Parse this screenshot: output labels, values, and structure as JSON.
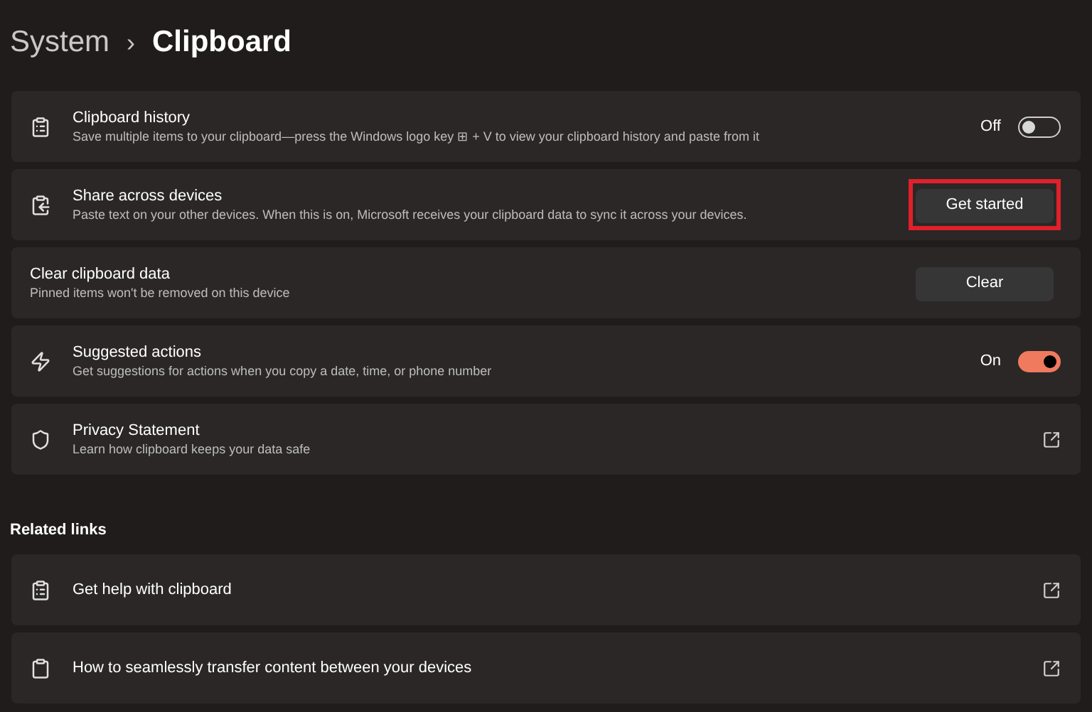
{
  "breadcrumb": {
    "parent": "System",
    "separator": "›",
    "current": "Clipboard"
  },
  "settings": [
    {
      "kind": "toggle",
      "title": "Clipboard history",
      "description": "Save multiple items to your clipboard—press the Windows logo key ⊞ + V to view your clipboard history and paste from it",
      "state_label": "Off",
      "on": false
    },
    {
      "kind": "button",
      "title": "Share across devices",
      "description": "Paste text on your other devices. When this is on, Microsoft receives your clipboard data to sync it across your devices.",
      "button": "Get started",
      "highlighted": true
    },
    {
      "kind": "button",
      "title": "Clear clipboard data",
      "description": "Pinned items won't be removed on this device",
      "button": "Clear",
      "highlighted": false
    },
    {
      "kind": "toggle",
      "title": "Suggested actions",
      "description": "Get suggestions for actions when you copy a date, time, or phone number",
      "state_label": "On",
      "on": true
    },
    {
      "kind": "link",
      "title": "Privacy Statement",
      "description": "Learn how clipboard keeps your data safe"
    }
  ],
  "related_links": {
    "heading": "Related links",
    "items": [
      {
        "title": "Get help with clipboard"
      },
      {
        "title": "How to seamlessly transfer content between your devices"
      }
    ]
  }
}
